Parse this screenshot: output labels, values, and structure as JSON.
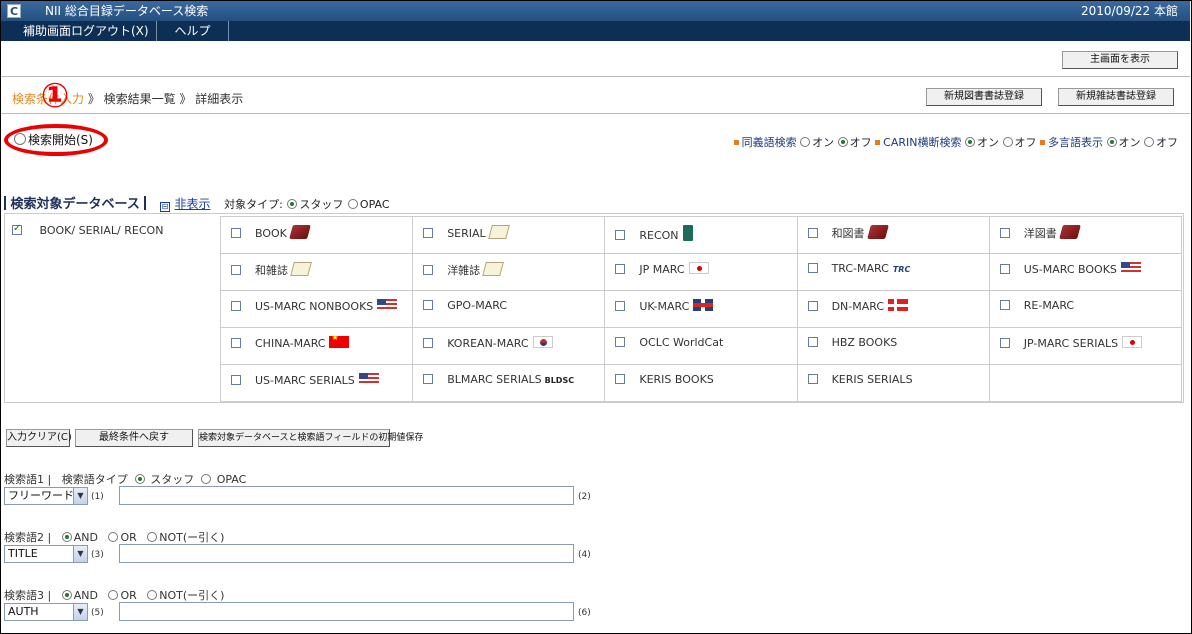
{
  "window": {
    "logo": "C",
    "title": "NII 総合目録データベース検索",
    "date": "2010/09/22 本館"
  },
  "menu": {
    "items": [
      "補助画面ログアウト(X)",
      "ヘルプ"
    ]
  },
  "toolbar": {
    "main_screen": "主画面を表示",
    "new_book": "新規図書書誌登録",
    "new_serial": "新規雑誌書誌登録"
  },
  "breadcrumb": {
    "link": "検索条件入力",
    "rest": "》 検索結果一覧 》 詳細表示"
  },
  "annotation": {
    "marker": "①"
  },
  "search_start": {
    "label": "検索開始(S)"
  },
  "options": {
    "synonym": {
      "label": "同義語検索",
      "on": "オン",
      "off": "オフ",
      "selected": "off"
    },
    "carin": {
      "label": "CARIN横断検索",
      "on": "オン",
      "off": "オフ",
      "selected": "on"
    },
    "multilang": {
      "label": "多言語表示",
      "on": "オン",
      "off": "オフ",
      "selected": "on"
    }
  },
  "db_section": {
    "title": "検索対象データベース",
    "hide_icon": "⊟",
    "hide_link": "非表示",
    "target_type_label": "対象タイプ:",
    "type_staff": "スタッフ",
    "type_opac": "OPAC",
    "group_label": "BOOK/ SERIAL/ RECON",
    "group_checked": true,
    "rows": [
      [
        {
          "label": "BOOK",
          "icon": "book-red-icon"
        },
        {
          "label": "SERIAL",
          "icon": "paper-icon"
        },
        {
          "label": "RECON",
          "icon": "book-green-icon"
        },
        {
          "label": "和図書",
          "icon": "book-red-icon"
        },
        {
          "label": "洋図書",
          "icon": "book-red-icon"
        }
      ],
      [
        {
          "label": "和雑誌",
          "icon": "paper-icon"
        },
        {
          "label": "洋雑誌",
          "icon": "paper-icon"
        },
        {
          "label": "JP MARC",
          "icon": "japan-flag-icon"
        },
        {
          "label": "TRC-MARC",
          "icon": "trc-logo",
          "mark": "TRC"
        },
        {
          "label": "US-MARC BOOKS",
          "icon": "us-flag-icon"
        }
      ],
      [
        {
          "label": "US-MARC NONBOOKS",
          "icon": "us-flag-icon"
        },
        {
          "label": "GPO-MARC",
          "icon": ""
        },
        {
          "label": "UK-MARC",
          "icon": "uk-flag-icon"
        },
        {
          "label": "DN-MARC",
          "icon": "denmark-flag-icon"
        },
        {
          "label": "RE-MARC",
          "icon": ""
        }
      ],
      [
        {
          "label": "CHINA-MARC",
          "icon": "china-flag-icon"
        },
        {
          "label": "KOREAN-MARC",
          "icon": "korea-flag-icon"
        },
        {
          "label": "OCLC WorldCat",
          "icon": ""
        },
        {
          "label": "HBZ BOOKS",
          "icon": ""
        },
        {
          "label": "JP-MARC SERIALS",
          "icon": "japan-flag-icon"
        }
      ],
      [
        {
          "label": "US-MARC SERIALS",
          "icon": "us-flag-icon"
        },
        {
          "label": "BLMARC SERIALS",
          "icon": "bldsc-logo",
          "mark": "BLDSC"
        },
        {
          "label": "KERIS BOOKS",
          "icon": ""
        },
        {
          "label": "KERIS SERIALS",
          "icon": ""
        },
        {
          "label": "",
          "icon": ""
        }
      ]
    ]
  },
  "actions": {
    "clear": "入力クリア(C)",
    "last": "最終条件へ戻す",
    "save": "検索対象データベースと検索語フィールドの初期値保存"
  },
  "term1": {
    "label": "検索語1 |",
    "type_label": "検索語タイプ",
    "staff": "スタッフ",
    "opac": "OPAC",
    "field": "フリーワード",
    "num_a": "(1)",
    "num_b": "(2)",
    "value": ""
  },
  "term2": {
    "label": "検索語2 |",
    "and": "AND",
    "or": "OR",
    "not": "NOT(ー引く)",
    "field": "TITLE",
    "num_a": "(3)",
    "num_b": "(4)",
    "value": ""
  },
  "term3": {
    "label": "検索語3 |",
    "and": "AND",
    "or": "OR",
    "not": "NOT(ー引く)",
    "field": "AUTH",
    "num_a": "(5)",
    "num_b": "(6)",
    "value": ""
  },
  "colors": {
    "title_bar": "#24517f",
    "menu_bar": "#0d2f55",
    "annotation": "#ee0000",
    "breadcrumb_link": "#e08a1a"
  }
}
